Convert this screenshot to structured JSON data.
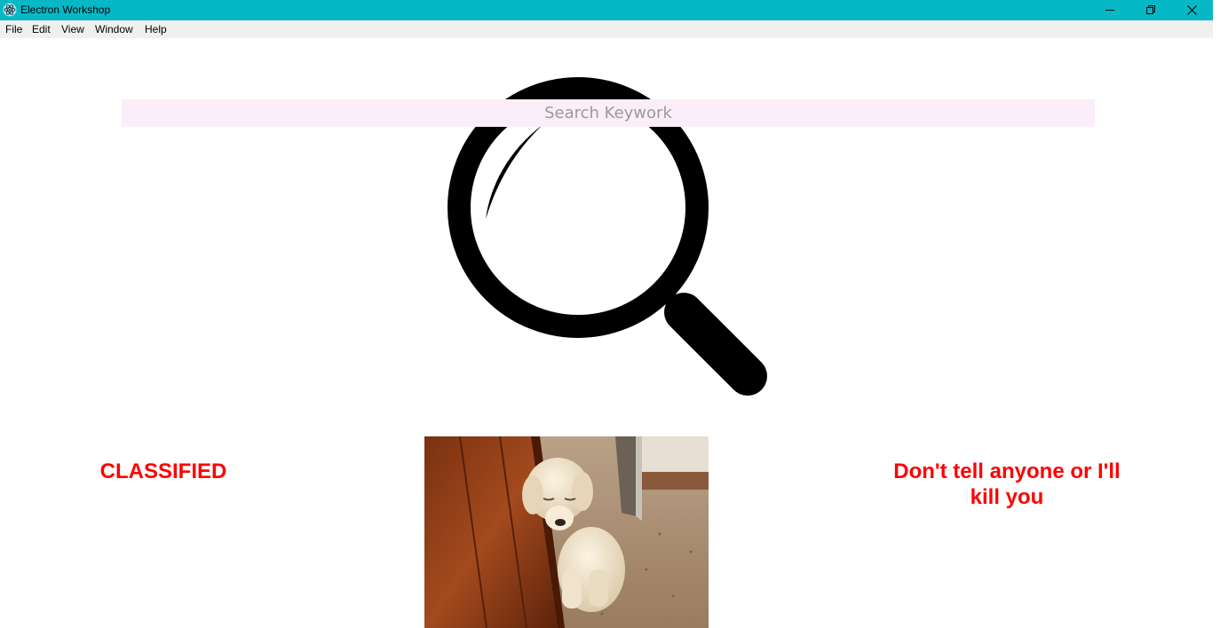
{
  "window": {
    "title": "Electron Workshop",
    "titlebar_color": "#06b8c6",
    "controls": [
      "minimize-icon",
      "restore-icon",
      "close-icon"
    ]
  },
  "menubar": {
    "items": [
      "File",
      "Edit",
      "View",
      "Window",
      "Help"
    ]
  },
  "search": {
    "placeholder": "Search Keywork",
    "value": "",
    "background": "#fbeef8"
  },
  "hero_icon": "magnifying-glass-icon",
  "left_text": "CLASSIFIED",
  "right_text": "Don't tell anyone or I'll kill you",
  "image": {
    "subject": "puppy-photo"
  },
  "accent_text_color": "#ff0000"
}
